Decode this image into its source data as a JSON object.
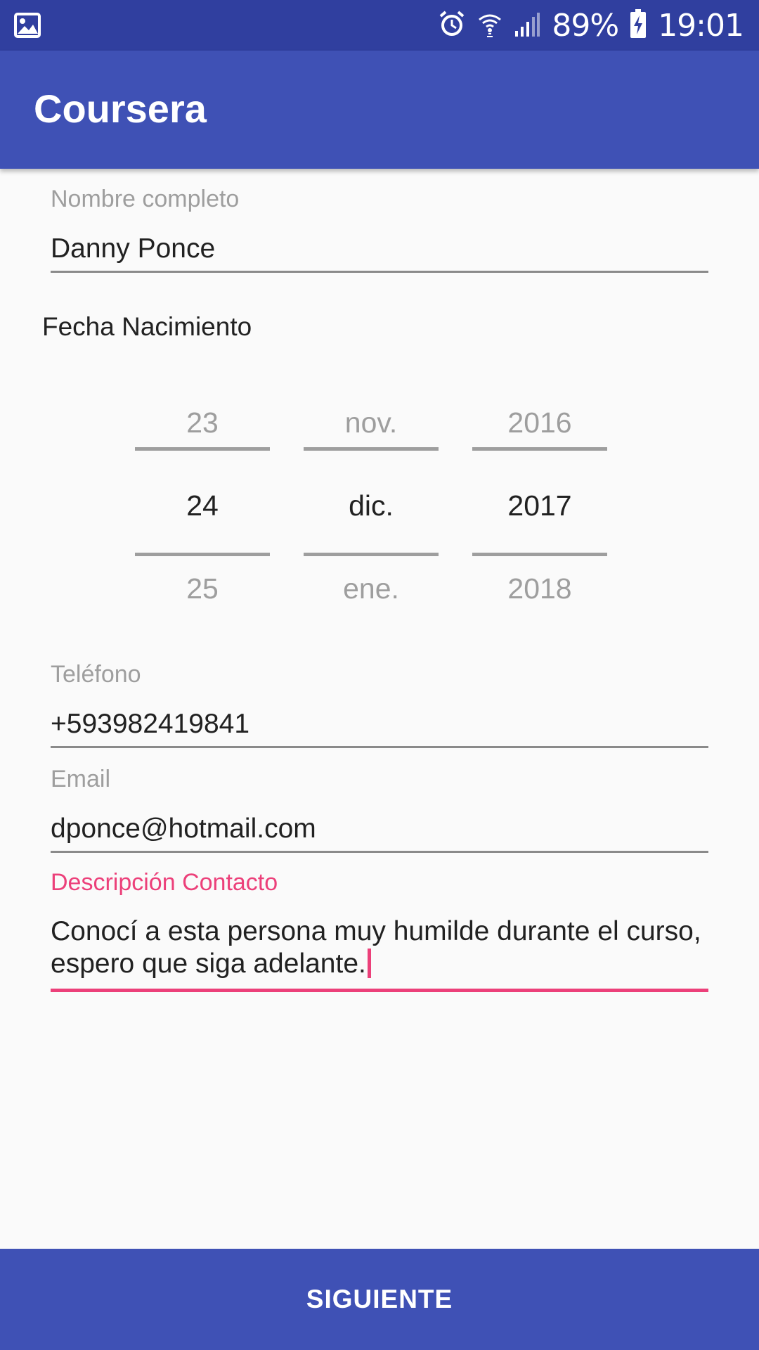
{
  "status_bar": {
    "battery": "89%",
    "time": "19:01",
    "icons": [
      "image-icon",
      "alarm-icon",
      "wifi-icon",
      "signal-icon",
      "battery-charging-icon"
    ]
  },
  "app_bar": {
    "title": "Coursera"
  },
  "form": {
    "name": {
      "label": "Nombre completo",
      "value": "Danny Ponce"
    },
    "birthdate": {
      "label": "Fecha Nacimiento",
      "day": {
        "prev": "23",
        "selected": "24",
        "next": "25"
      },
      "month": {
        "prev": "nov.",
        "selected": "dic.",
        "next": "ene."
      },
      "year": {
        "prev": "2016",
        "selected": "2017",
        "next": "2018"
      }
    },
    "phone": {
      "label": "Teléfono",
      "value": "+593982419841"
    },
    "email": {
      "label": "Email",
      "value": "dponce@hotmail.com"
    },
    "description": {
      "label": "Descripción Contacto",
      "value": "Conocí a esta persona muy humilde durante el curso, espero que siga adelante."
    }
  },
  "next_button": {
    "label": "SIGUIENTE"
  },
  "colors": {
    "primary": "#3F51B5",
    "primary_dark": "#303F9F",
    "accent": "#EC407A"
  }
}
